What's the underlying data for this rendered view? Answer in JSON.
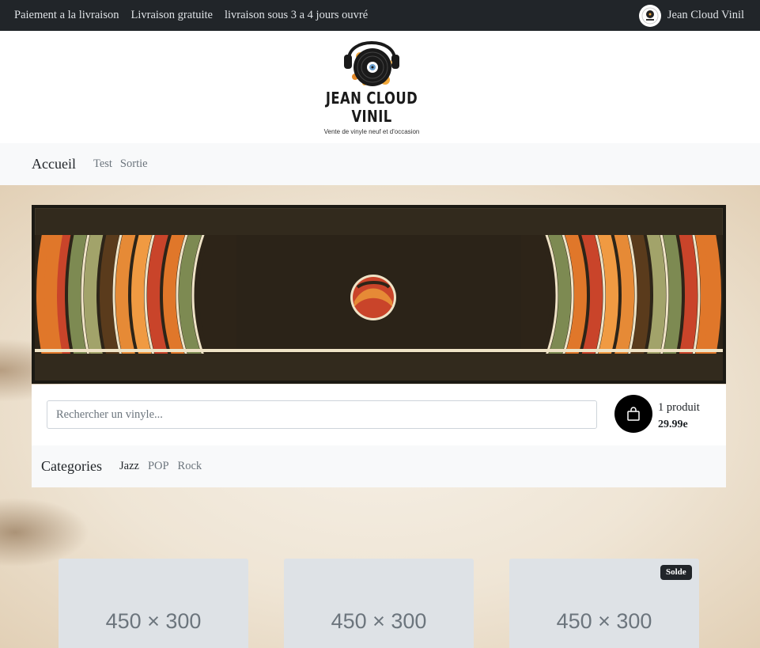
{
  "topbar": {
    "info_items": [
      "Paiement a la livraison",
      "Livraison gratuite",
      "livraison sous 3 a 4 jours ouvré"
    ],
    "account_name": "Jean Cloud Vinil",
    "account_icon": "user-avatar-icon"
  },
  "logo": {
    "title_line1": "JEAN CLOUD",
    "title_line2": "VINIL",
    "subtitle": "Vente de vinyle neuf et d'occasion"
  },
  "nav": {
    "brand": "Accueil",
    "links": [
      "Test",
      "Sortie"
    ]
  },
  "search": {
    "placeholder": "Rechercher un vinyle...",
    "value": ""
  },
  "cart": {
    "icon": "shopping-bag-icon",
    "count_label": "1 produit",
    "total": "29.99e"
  },
  "categories": {
    "title": "Categories",
    "items": [
      "Jazz",
      "POP",
      "Rock"
    ],
    "active_index": 0
  },
  "products": [
    {
      "placeholder": "450 × 300",
      "badge": ""
    },
    {
      "placeholder": "450 × 300",
      "badge": ""
    },
    {
      "placeholder": "450 × 300",
      "badge": "Solde"
    }
  ],
  "colors": {
    "topbar_bg": "#212529",
    "nav_bg": "#f8f9fa",
    "card_bg": "#dee2e6",
    "cart_button": "#000000",
    "banner_orange": "#e0772a",
    "banner_red": "#c9442a",
    "banner_green": "#7d8a52",
    "banner_brown": "#5a3b1c"
  }
}
